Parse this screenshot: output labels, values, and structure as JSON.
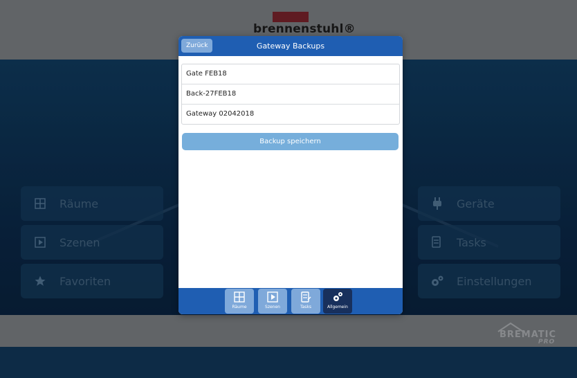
{
  "brand": {
    "name": "brennenstuhl®"
  },
  "background": {
    "left_tiles": [
      {
        "label": "Räume",
        "icon": "grid-icon"
      },
      {
        "label": "Szenen",
        "icon": "play-icon"
      },
      {
        "label": "Favoriten",
        "icon": "star-icon"
      }
    ],
    "right_tiles": [
      {
        "label": "Geräte",
        "icon": "plug-icon"
      },
      {
        "label": "Tasks",
        "icon": "task-icon"
      },
      {
        "label": "Einstellungen",
        "icon": "gears-icon"
      }
    ],
    "footer_logo": "BREMATIC PRO"
  },
  "modal": {
    "back_label": "Zurück",
    "title": "Gateway Backups",
    "backups": [
      "Gate  FEB18",
      "Back-27FEB18",
      "Gateway 02042018"
    ],
    "save_label": "Backup speichern"
  },
  "tabbar": {
    "tabs": [
      {
        "label": "Räume",
        "icon": "grid-icon",
        "active": false
      },
      {
        "label": "Szenen",
        "icon": "play-icon",
        "active": false
      },
      {
        "label": "Tasks",
        "icon": "task-icon",
        "active": false
      },
      {
        "label": "Allgemein",
        "icon": "gears-icon",
        "active": true
      }
    ]
  },
  "colors": {
    "header_blue": "#1f5eb2",
    "button_light_blue": "#76aedb",
    "active_tab": "#18305c",
    "brand_red": "#6d1f27"
  }
}
